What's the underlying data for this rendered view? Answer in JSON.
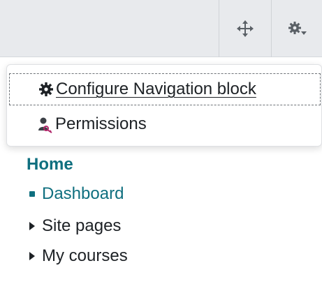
{
  "header": {
    "move_icon": "move-arrows-icon",
    "actions_icon": "gear-dropdown-icon"
  },
  "menu": {
    "items": [
      {
        "label": "Configure Navigation block",
        "icon": "gear-icon"
      },
      {
        "label": "Permissions",
        "icon": "user-key-icon"
      }
    ]
  },
  "nav": {
    "home": "Home",
    "items": [
      {
        "label": "Dashboard",
        "marker": "bullet"
      },
      {
        "label": "Site pages",
        "marker": "collapsed-triangle"
      },
      {
        "label": "My courses",
        "marker": "collapsed-triangle"
      }
    ]
  },
  "colors": {
    "accent": "#0f6f7f",
    "header_bg": "#e8eaed",
    "text": "#1d2125"
  }
}
